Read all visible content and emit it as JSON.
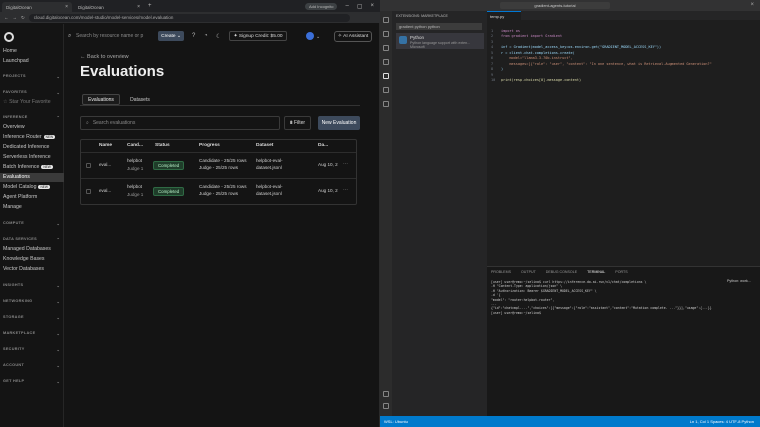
{
  "browser": {
    "tabs": [
      {
        "label": "DigitalOcean"
      },
      {
        "label": "DigitalOcean"
      }
    ],
    "new_tab": "+",
    "incognito": "Add Incognito",
    "url": "cloud.digitalocean.com/model-studio/model-services/model.evaluation"
  },
  "sidebar": {
    "top_items": [
      "Home",
      "Launchpad"
    ],
    "sections": [
      {
        "label": "PROJECTS"
      },
      {
        "label": "FAVORITES",
        "items": [
          "Star Your Favorite"
        ]
      },
      {
        "label": "INFERENCE",
        "items": [
          "Overview",
          "Inference Router",
          "Dedicated Inference",
          "Serverless Inference",
          "Batch Inference",
          "Evaluations",
          "Model Catalog",
          "Agent Platform",
          "Manage"
        ]
      },
      {
        "label": "COMPUTE"
      },
      {
        "label": "DATA SERVICES",
        "items": [
          "Managed Databases",
          "Knowledge Bases",
          "Vector Databases"
        ]
      },
      {
        "label": "INSIGHTS"
      },
      {
        "label": "NETWORKING"
      },
      {
        "label": "STORAGE"
      },
      {
        "label": "MARKETPLACE"
      },
      {
        "label": "SECURITY"
      },
      {
        "label": "ACCOUNT"
      },
      {
        "label": "GET HELP"
      }
    ],
    "badge_new": "NEW"
  },
  "topnav": {
    "search_placeholder": "Search by resource name or p",
    "create": "Create",
    "signup_credit": "Signup Credit: $5.00",
    "ai_assistant": "AI Assistant"
  },
  "page": {
    "back": "Back to overview",
    "title": "Evaluations",
    "tabs": [
      "Evaluations",
      "Datasets"
    ],
    "search_placeholder": "Search evaluations",
    "filter": "Filter",
    "new_eval": "New Evaluation",
    "columns": [
      "Name",
      "Cand...",
      "Status",
      "Progress",
      "Dataset",
      "Da..."
    ],
    "rows": [
      {
        "name": "eval...",
        "cand": "helpbot",
        "judge": "Judge 1",
        "status": "Completed",
        "progress_cand": "Candidate - 25/25 rows",
        "progress_judge": "Judge - 25/25 rows",
        "dataset_1": "helpbot-eval-",
        "dataset_2": "dataset.jsonl",
        "date": "Aug 10, 2"
      },
      {
        "name": "eval...",
        "cand": "helpbot",
        "judge": "Judge 1",
        "status": "Completed",
        "progress_cand": "Candidate - 25/25 rows",
        "progress_judge": "Judge - 25/25 rows",
        "dataset_1": "helpbot-eval-",
        "dataset_2": "dataset.jsonl",
        "date": "Aug 10, 2"
      }
    ]
  },
  "vscode": {
    "command_center": "gradient-agents-tutorial",
    "panel_title": "EXTENSIONS: MARKETPLACE",
    "ext_search": "gradient python python",
    "ext_name": "Python",
    "ext_desc": "Python language support with exten...",
    "ext_publisher": "Microsoft",
    "editor_tab": "temp.py",
    "code_lines": [
      "import os",
      "from gradient import Gradient",
      "",
      "inf = Gradient(model_access_key=os.environ.get(\"GRADIENT_MODEL_ACCESS_KEY\"))",
      "r = client.chat.completions.create(",
      "    model=\"llama3.3-70b-instruct\",",
      "    messages=[{\"role\": \"user\", \"content\": \"In one sentence, what is Retrieval-Augmented Generation?\"",
      ")",
      "",
      "print(resp.choices[0].message.content)"
    ],
    "term_tabs": [
      "TERMINAL",
      "PROBLEMS",
      "OUTPUT",
      "DEBUG CONSOLE",
      "PORTS"
    ],
    "term_lines": [
      "[user] user@remo:~/selina$ curl https://inference.do-ai.run/v1/chat/completions \\",
      "  -H \"Content-Type: application/json\" \\",
      "  -H \"Authorization: Bearer $GRADIENT_MODEL_ACCESS_KEY\" \\",
      "  -d '{",
      "    \"model\": \"router:helpbot-router\",",
      "    ...",
      "{\"id\":\"chatcmpl-...\",\"choices\":[{\"message\":{\"role\":\"assistant\",\"content\":\"Mutation complete. ...\"}}],\"usage\":{...}}",
      "[user] user@remo:~/selina$ "
    ],
    "term_side": "Python: work...",
    "status_left": "WSL: Ubuntu",
    "status_right": "Ln 1, Col 1  Spaces: 4  UTF-8  Python"
  }
}
